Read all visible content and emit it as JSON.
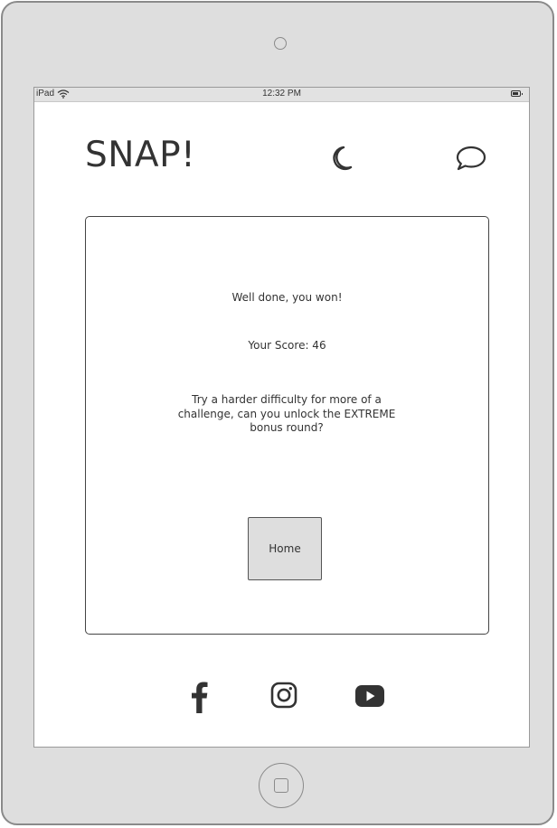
{
  "status_bar": {
    "device": "iPad",
    "time": "12:32 PM"
  },
  "header": {
    "logo": "SNAP!",
    "icons": [
      "moon-icon",
      "chat-bubble-icon"
    ]
  },
  "result_card": {
    "message": "Well done, you won!",
    "score_text": "Your Score: 46",
    "tip": "Try a harder difficulty for more of a challenge, can you unlock the EXTREME bonus round?",
    "home_button_label": "Home"
  },
  "footer": {
    "social_icons": [
      "facebook-icon",
      "instagram-icon",
      "youtube-icon"
    ]
  },
  "colors": {
    "device_frame": "#dedede",
    "text": "#333333",
    "button_bg": "#dedede"
  }
}
